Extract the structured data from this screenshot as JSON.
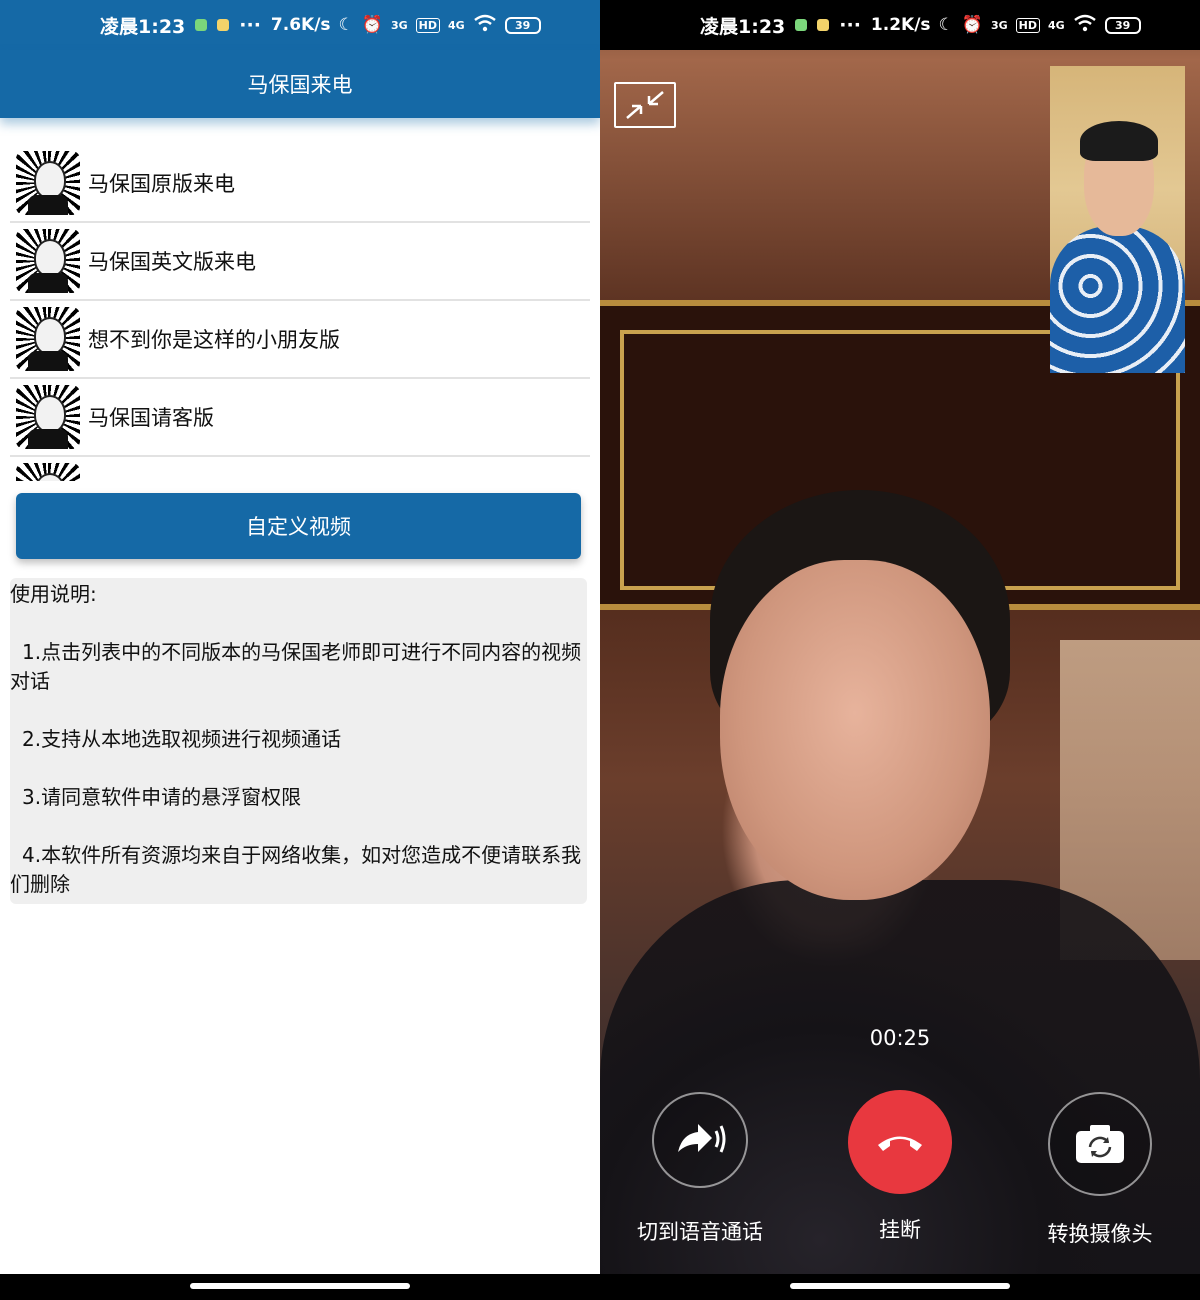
{
  "left": {
    "status": {
      "time": "凌晨1:23",
      "more": "···",
      "speed": "7.6K/s",
      "moon": "☾",
      "alarm": "⏰",
      "sig3g": "3G",
      "hd": "HD",
      "sig4g": "4G",
      "battery": "39"
    },
    "app_title": "马保国来电",
    "list_items": [
      {
        "label": "马保国原版来电"
      },
      {
        "label": "马保国英文版来电"
      },
      {
        "label": "想不到你是这样的小朋友版"
      },
      {
        "label": "马保国请客版"
      }
    ],
    "custom_button": "自定义视频",
    "instructions": {
      "title": "使用说明:",
      "items": [
        "1.点击列表中的不同版本的马保国老师即可进行不同内容的视频对话",
        "2.支持从本地选取视频进行视频通话",
        "3.请同意软件申请的悬浮窗权限",
        "4.本软件所有资源均来自于网络收集，如对您造成不便请联系我们删除"
      ]
    }
  },
  "right": {
    "status": {
      "time": "凌晨1:23",
      "more": "···",
      "speed": "1.2K/s",
      "moon": "☾",
      "alarm": "⏰",
      "sig3g": "3G",
      "hd": "HD",
      "sig4g": "4G",
      "battery": "39"
    },
    "timer": "00:25",
    "controls": {
      "voice_label": "切到语音通话",
      "hangup_label": "挂断",
      "switch_camera_label": "转换摄像头"
    }
  },
  "colors": {
    "primary": "#1569a6",
    "hangup": "#e8383f",
    "list_divider": "#e2e2e2",
    "instructions_bg": "#efefef"
  },
  "icons": [
    "minimize-icon",
    "voice-switch-icon",
    "hangup-icon",
    "camera-switch-icon",
    "avatar-image"
  ]
}
